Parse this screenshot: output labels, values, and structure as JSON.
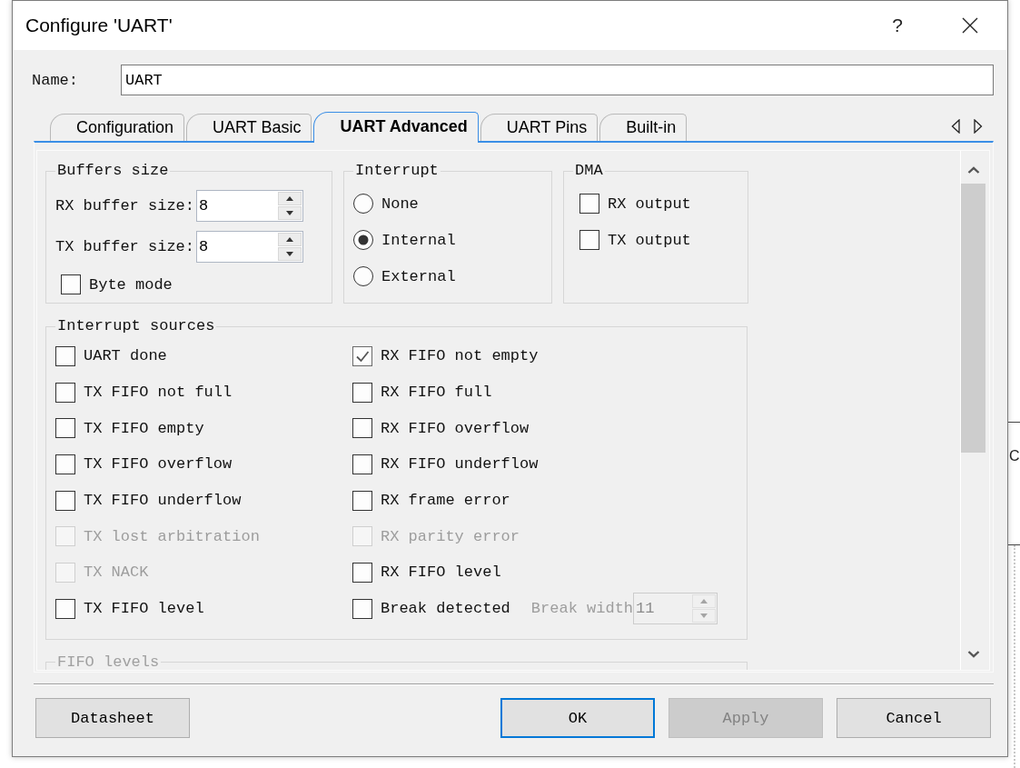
{
  "window": {
    "title": "Configure 'UART'",
    "help_button": "?"
  },
  "name_field": {
    "label": "Name:",
    "value": "UART"
  },
  "tabs": [
    {
      "label": "Configuration",
      "selected": false
    },
    {
      "label": "UART Basic",
      "selected": false
    },
    {
      "label": "UART Advanced",
      "selected": true
    },
    {
      "label": "UART Pins",
      "selected": false
    },
    {
      "label": "Built-in",
      "selected": false
    }
  ],
  "buffers_size": {
    "title": "Buffers size",
    "fields": [
      {
        "label": "RX buffer size:",
        "value": "8"
      },
      {
        "label": "TX buffer size:",
        "value": "8"
      }
    ],
    "byte_mode": {
      "label": "Byte mode",
      "checked": false
    }
  },
  "interrupt": {
    "title": "Interrupt",
    "options": [
      {
        "label": "None",
        "selected": false
      },
      {
        "label": "Internal",
        "selected": true
      },
      {
        "label": "External",
        "selected": false
      }
    ]
  },
  "dma": {
    "title": "DMA",
    "options": [
      {
        "label": "RX output",
        "checked": false
      },
      {
        "label": "TX output",
        "checked": false
      }
    ]
  },
  "interrupt_sources": {
    "title": "Interrupt sources",
    "left": [
      {
        "label": "UART done",
        "checked": false,
        "disabled": false
      },
      {
        "label": "TX FIFO not full",
        "checked": false,
        "disabled": false
      },
      {
        "label": "TX FIFO empty",
        "checked": false,
        "disabled": false
      },
      {
        "label": "TX FIFO overflow",
        "checked": false,
        "disabled": false
      },
      {
        "label": "TX FIFO underflow",
        "checked": false,
        "disabled": false
      },
      {
        "label": "TX lost arbitration",
        "checked": false,
        "disabled": true
      },
      {
        "label": "TX NACK",
        "checked": false,
        "disabled": true
      },
      {
        "label": "TX FIFO level",
        "checked": false,
        "disabled": false
      }
    ],
    "right": [
      {
        "label": "RX FIFO not empty",
        "checked": true,
        "disabled": false
      },
      {
        "label": "RX FIFO full",
        "checked": false,
        "disabled": false
      },
      {
        "label": "RX FIFO overflow",
        "checked": false,
        "disabled": false
      },
      {
        "label": "RX FIFO underflow",
        "checked": false,
        "disabled": false
      },
      {
        "label": "RX frame error",
        "checked": false,
        "disabled": false
      },
      {
        "label": "RX parity error",
        "checked": false,
        "disabled": true
      },
      {
        "label": "RX FIFO level",
        "checked": false,
        "disabled": false
      },
      {
        "label": "Break detected",
        "checked": false,
        "disabled": false,
        "break_width": {
          "label": "Break width",
          "value": "11",
          "disabled": true
        }
      }
    ]
  },
  "fifo_levels": {
    "title": "FIFO levels",
    "disabled": true
  },
  "buttons": [
    {
      "label": "Datasheet",
      "default": false,
      "disabled": false
    },
    {
      "label": "OK",
      "default": true,
      "disabled": false
    },
    {
      "label": "Apply",
      "default": false,
      "disabled": true
    },
    {
      "label": "Cancel",
      "default": false,
      "disabled": false
    }
  ],
  "background_window": {
    "text": "C"
  }
}
